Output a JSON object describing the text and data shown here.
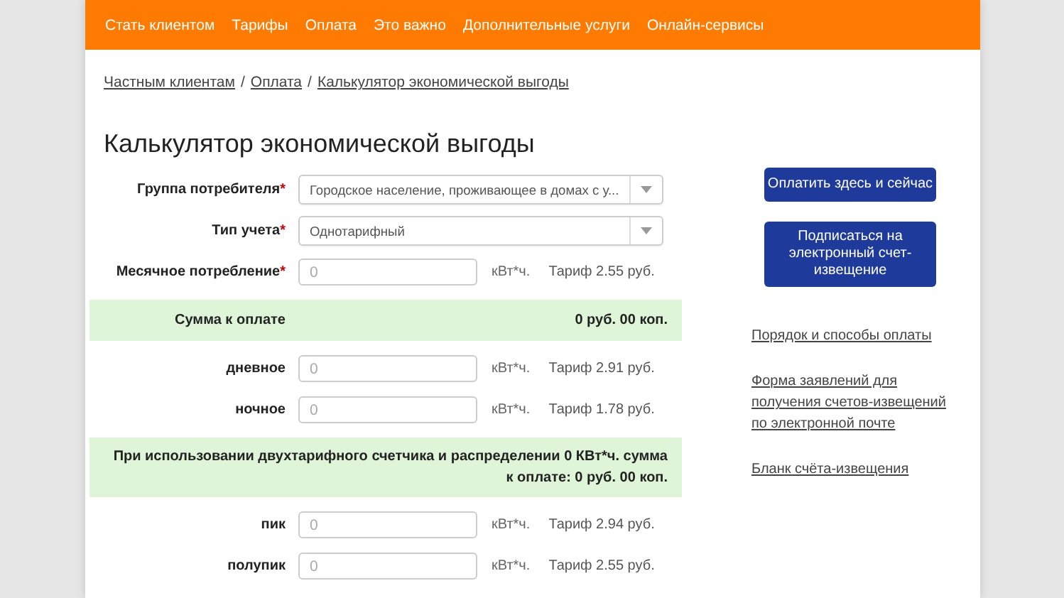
{
  "nav": [
    "Стать клиентом",
    "Тарифы",
    "Оплата",
    "Это важно",
    "Дополнительные услуги",
    "Онлайн-сервисы"
  ],
  "breadcrumbs": [
    "Частным клиентам",
    "Оплата",
    "Калькулятор экономической выгоды"
  ],
  "breadcrumb_separator": "/",
  "required_mark": "*",
  "title": "Калькулятор экономической выгоды",
  "rows": [
    {
      "kind": "select",
      "label": "Группа потребителя",
      "required": true,
      "value": "Городское население, проживающее в домах с у..."
    },
    {
      "kind": "select",
      "label": "Тип учета",
      "required": true,
      "value": "Однотарифный"
    },
    {
      "kind": "input",
      "label": "Месячное потребление",
      "required": true,
      "placeholder": "0",
      "unit": "кВт*ч.",
      "tariff": "Тариф 2.55 руб."
    },
    {
      "kind": "sum",
      "label": "Сумма к оплате",
      "amount": "0 руб. 00 коп."
    },
    {
      "kind": "input",
      "label": "дневное",
      "required": false,
      "placeholder": "0",
      "unit": "кВт*ч.",
      "tariff": "Тариф 2.91 руб."
    },
    {
      "kind": "input",
      "label": "ночное",
      "required": false,
      "placeholder": "0",
      "unit": "кВт*ч.",
      "tariff": "Тариф 1.78 руб."
    },
    {
      "kind": "note",
      "text": "При использовании двухтарифного счетчика и распределении 0 КВт*ч. сумма к оплате: 0 руб. 00 коп."
    },
    {
      "kind": "input",
      "label": "пик",
      "required": false,
      "placeholder": "0",
      "unit": "кВт*ч.",
      "tariff": "Тариф 2.94 руб."
    },
    {
      "kind": "input",
      "label": "полупик",
      "required": false,
      "placeholder": "0",
      "unit": "кВт*ч.",
      "tariff": "Тариф 2.55 руб."
    }
  ],
  "buttons": [
    "Оплатить здесь и сейчас",
    "Подписаться на электронный счет-извещение"
  ],
  "links": [
    "Порядок и способы оплаты",
    "Форма заявлений для получения счетов-извещений по электронной почте",
    "Бланк счёта-извещения"
  ]
}
